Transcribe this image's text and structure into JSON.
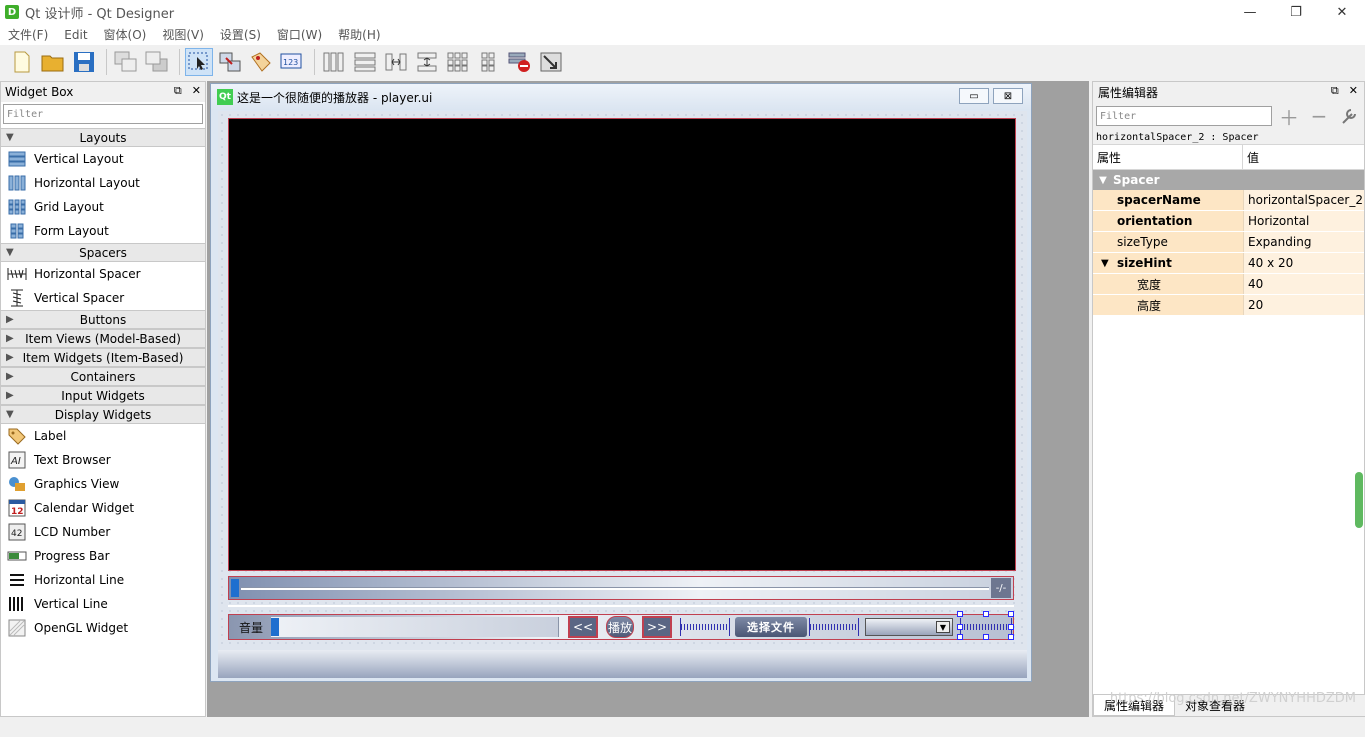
{
  "window": {
    "title": "Qt 设计师 - Qt Designer",
    "icon_letter": "D",
    "controls": [
      "—",
      "❐",
      "✕"
    ]
  },
  "menu": [
    "文件(F)",
    "Edit",
    "窗体(O)",
    "视图(V)",
    "设置(S)",
    "窗口(W)",
    "帮助(H)"
  ],
  "widget_box": {
    "title": "Widget Box",
    "filter_placeholder": "Filter",
    "categories": {
      "layouts": "Layouts",
      "spacers": "Spacers",
      "buttons": "Buttons",
      "item_views": "Item Views (Model-Based)",
      "item_widgets": "Item Widgets (Item-Based)",
      "containers": "Containers",
      "input_widgets": "Input Widgets",
      "display_widgets": "Display Widgets"
    },
    "layout_items": [
      "Vertical Layout",
      "Horizontal Layout",
      "Grid Layout",
      "Form Layout"
    ],
    "spacer_items": [
      "Horizontal Spacer",
      "Vertical Spacer"
    ],
    "display_items": [
      "Label",
      "Text Browser",
      "Graphics View",
      "Calendar Widget",
      "LCD Number",
      "Progress Bar",
      "Horizontal Line",
      "Vertical Line",
      "OpenGL Widget"
    ]
  },
  "form": {
    "title": "这是一个很随便的播放器 - player.ui",
    "qt_badge": "Qt",
    "progress_end": "-/-",
    "volume_label": "音量",
    "rewind_label": "<<",
    "play_label": "播放",
    "forward_label": ">>",
    "select_file_label": "选择文件"
  },
  "property_editor": {
    "title": "属性编辑器",
    "filter_placeholder": "Filter",
    "object_name": "horizontalSpacer_2 : Spacer",
    "col_property": "属性",
    "col_value": "值",
    "group": "Spacer",
    "rows": [
      {
        "name": "spacerName",
        "value": "horizontalSpacer_2"
      },
      {
        "name": "orientation",
        "value": "Horizontal"
      },
      {
        "name": "sizeType",
        "value": "Expanding"
      },
      {
        "name": "sizeHint",
        "value": "40 x 20"
      },
      {
        "name": "宽度",
        "value": "40"
      },
      {
        "name": "高度",
        "value": "20"
      }
    ],
    "tabs": [
      "属性编辑器",
      "对象查看器"
    ]
  },
  "watermark": "https://blog.csdn.net/ZWYNYHHDZDM"
}
